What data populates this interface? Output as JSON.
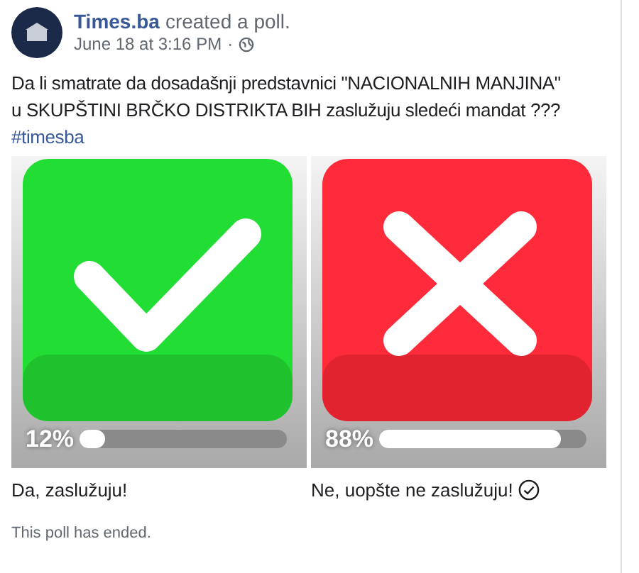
{
  "post": {
    "author": "Times.ba",
    "action": "created a poll.",
    "time": "June 18 at 3:16 PM",
    "separator": "·",
    "text_lines": [
      "Da li smatrate da dosadašnji predstavnici \"NACIONALNIH MANJINA\"",
      "u SKUPŠTINI BRČKO DISTRIKTA BIH zaslužuju sledeći mandat ???"
    ],
    "hashtag": "#timesba"
  },
  "poll": {
    "options": [
      {
        "kind": "yes",
        "percent": "12%",
        "level": 0.12,
        "label": "Da, zaslužuju!",
        "voted": false
      },
      {
        "kind": "no",
        "percent": "88%",
        "level": 0.88,
        "label": "Ne, uopšte ne zaslužuju!",
        "voted": true
      }
    ],
    "status": "This poll has ended."
  }
}
